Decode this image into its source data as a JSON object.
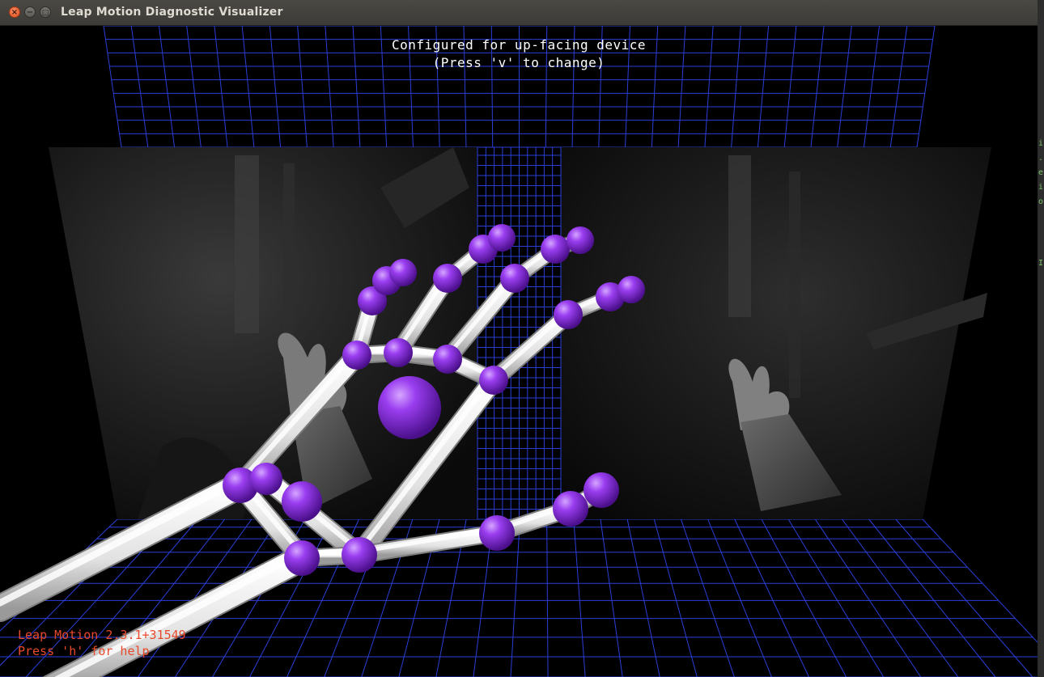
{
  "window": {
    "title": "Leap Motion Diagnostic Visualizer",
    "close_symbol": "×",
    "minimize_symbol": "−",
    "maximize_symbol": "□"
  },
  "overlay": {
    "config_line1": "Configured for up-facing device",
    "config_line2": "(Press 'v' to change)",
    "version": "Leap Motion 2.3.1+31549",
    "help_hint": "Press 'h' for help"
  },
  "colors": {
    "grid": "#2a3fd8",
    "joint": "#8a2be2",
    "bone": "#f2f2f2",
    "footer_text": "#e8492a"
  },
  "icons": {
    "close": "close-icon",
    "minimize": "minimize-icon",
    "maximize": "maximize-icon"
  }
}
